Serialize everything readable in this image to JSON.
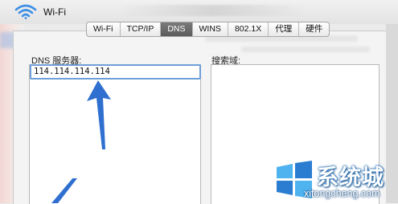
{
  "window": {
    "title": "Wi-Fi",
    "icon": "wifi-icon"
  },
  "tabs": [
    {
      "label": "Wi-Fi",
      "active": false
    },
    {
      "label": "TCP/IP",
      "active": false
    },
    {
      "label": "DNS",
      "active": true
    },
    {
      "label": "WINS",
      "active": false
    },
    {
      "label": "802.1X",
      "active": false
    },
    {
      "label": "代理",
      "active": false
    },
    {
      "label": "硬件",
      "active": false
    }
  ],
  "dns": {
    "label": "DNS 服务器:",
    "servers": [
      "114.114.114.114"
    ]
  },
  "search_domains": {
    "label": "搜索域:",
    "entries": []
  },
  "watermark": {
    "name": "系统城",
    "url": "xitongcheng.com",
    "colors": {
      "blue": "#2a7dd1",
      "light_blue": "#4fb3f0"
    }
  },
  "colors": {
    "accent": "#6e9fd8",
    "arrow": "#2f6fd0",
    "tab_active": "#666666"
  }
}
